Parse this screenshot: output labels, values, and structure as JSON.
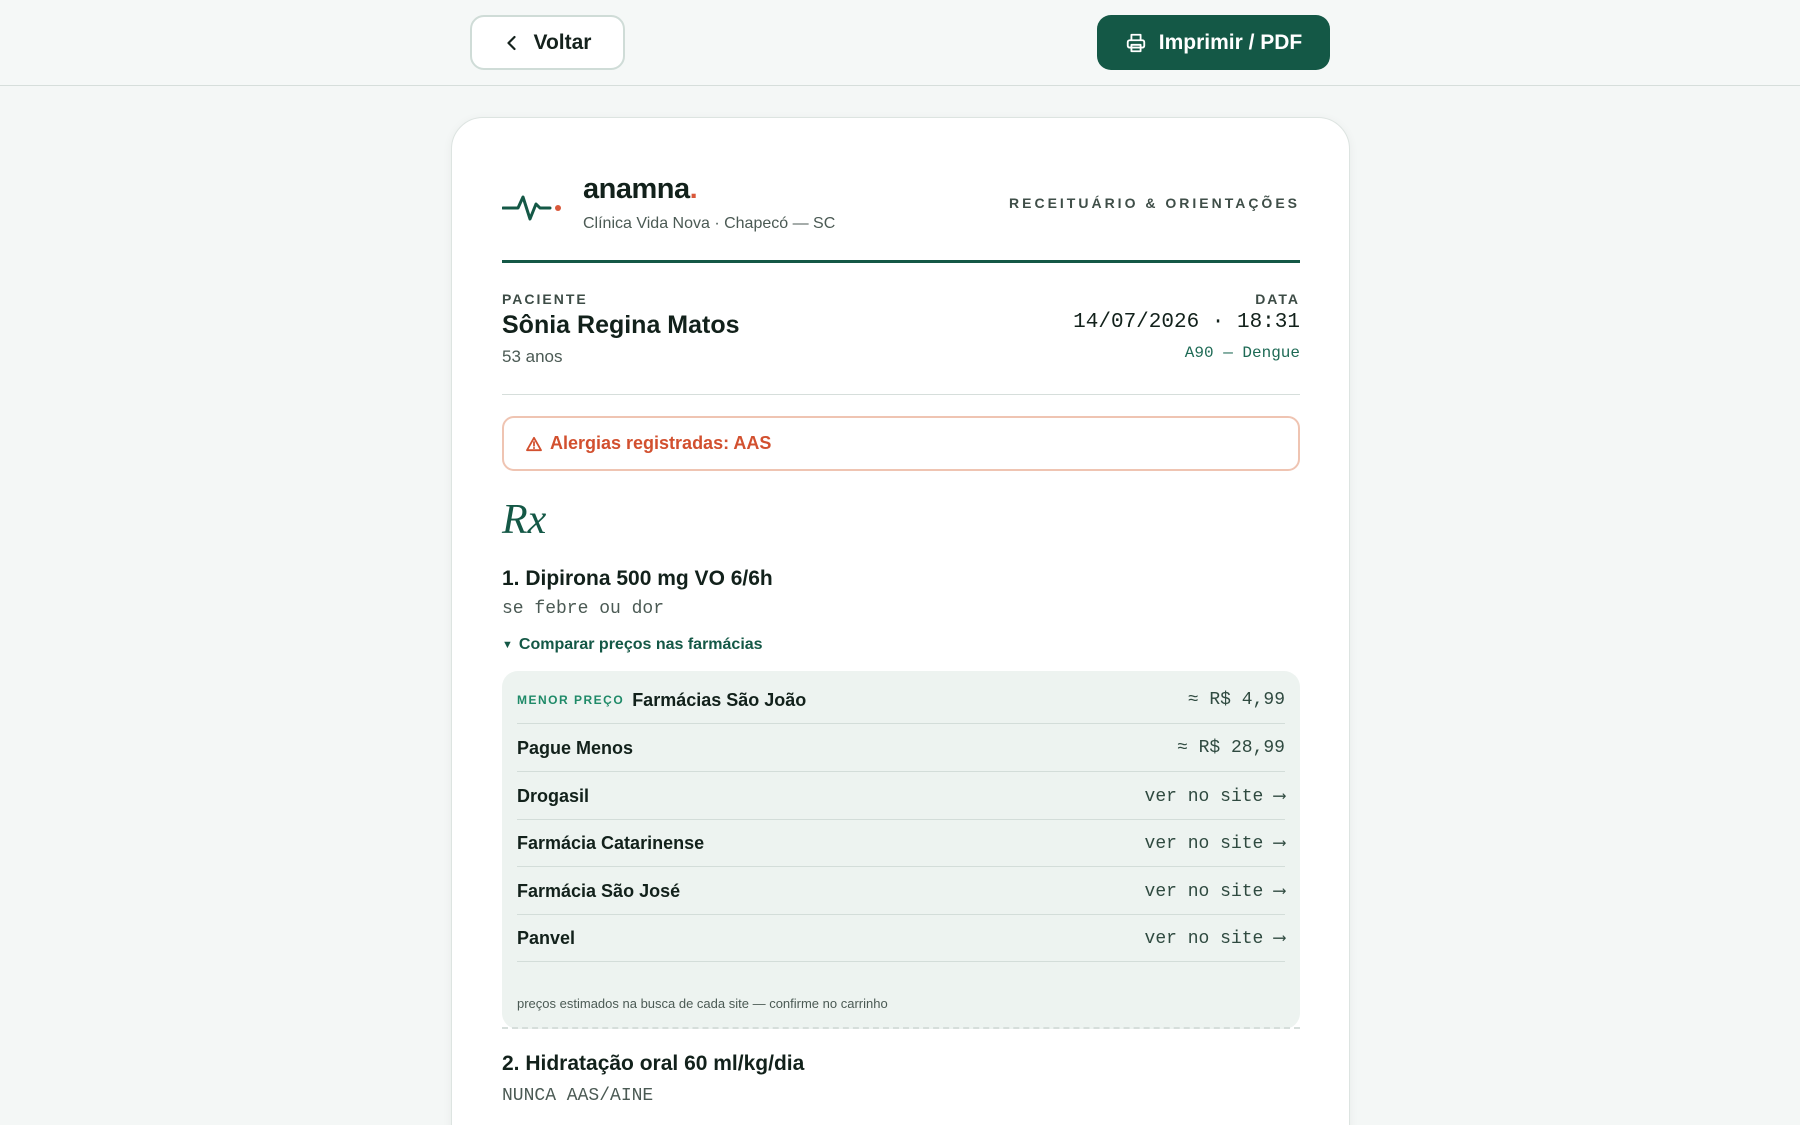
{
  "toolbar": {
    "back_label": "Voltar",
    "print_label": "Imprimir / PDF"
  },
  "brand": {
    "name": "anamna",
    "dot": ".",
    "clinic": "Clínica Vida Nova · Chapecó — SC",
    "doc_type": "RECEITUÁRIO & ORIENTAÇÕES",
    "accent_color": "#145846",
    "dot_color": "#d9583a"
  },
  "patient": {
    "label": "PACIENTE",
    "name": "Sônia Regina Matos",
    "age": "53 anos"
  },
  "date": {
    "label": "DATA",
    "value": "14/07/2026 · 18:31",
    "diagnosis": "A90 — Dengue"
  },
  "allergy": {
    "icon": "warning-icon",
    "text": "Alergias registradas: AAS"
  },
  "rx_symbol": "Rx",
  "prescriptions": [
    {
      "title": "1. Dipirona 500 mg VO 6/6h",
      "note": "se febre ou dor",
      "compare_label": "Comparar preços nas farmácias",
      "pharmacies": [
        {
          "badge": "MENOR PREÇO",
          "name": "Farmácias São João",
          "value": "≈ R$ 4,99"
        },
        {
          "name": "Pague Menos",
          "value": "≈ R$ 28,99"
        },
        {
          "name": "Drogasil",
          "value": "ver no site ⟶"
        },
        {
          "name": "Farmácia Catarinense",
          "value": "ver no site ⟶"
        },
        {
          "name": "Farmácia São José",
          "value": "ver no site ⟶"
        },
        {
          "name": "Panvel",
          "value": "ver no site ⟶"
        }
      ],
      "prices_note": "preços estimados na busca de cada site — confirme no carrinho"
    },
    {
      "title": "2. Hidratação oral 60 ml/kg/dia",
      "note": "NUNCA AAS/AINE"
    }
  ]
}
